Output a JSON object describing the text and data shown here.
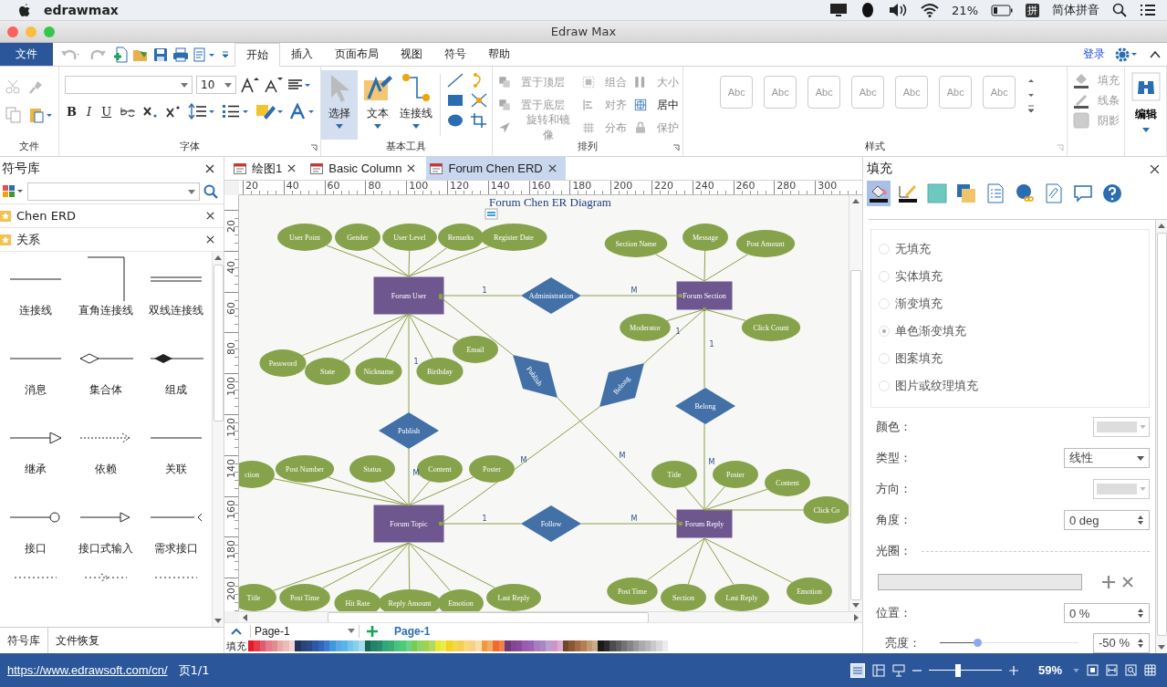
{
  "menubar": {
    "app": "edrawmax",
    "battery": "21%",
    "input_method_icon": "拼",
    "input_method": "简体拼音"
  },
  "window": {
    "title": "Edraw Max"
  },
  "ribbon": {
    "file_button": "文件",
    "tabs": [
      {
        "label": "开始",
        "selected": true
      },
      {
        "label": "插入",
        "selected": false
      },
      {
        "label": "页面布局",
        "selected": false
      },
      {
        "label": "视图",
        "selected": false
      },
      {
        "label": "符号",
        "selected": false
      },
      {
        "label": "帮助",
        "selected": false
      }
    ],
    "login": "登录",
    "file_group": "文件",
    "font_group": "字体",
    "font_size": "10",
    "font_styles": [
      "B",
      "I",
      "U"
    ],
    "basic_tools": {
      "label": "基本工具",
      "tools": [
        {
          "label": "选择",
          "selected": true
        },
        {
          "label": "文本",
          "selected": false
        },
        {
          "label": "连接线",
          "selected": false
        }
      ]
    },
    "arrange": {
      "label": "排列",
      "items": [
        {
          "label": "置于顶层",
          "disabled": true
        },
        {
          "label": "置于底层",
          "disabled": true
        },
        {
          "label": "旋转和镜像",
          "disabled": true
        },
        {
          "label": "组合",
          "disabled": true
        },
        {
          "label": "对齐",
          "disabled": true
        },
        {
          "label": "分布",
          "disabled": true
        },
        {
          "label": "大小",
          "disabled": true
        },
        {
          "label": "居中",
          "disabled": false
        },
        {
          "label": "保护",
          "disabled": true
        }
      ]
    },
    "styles": {
      "label": "样式",
      "swatches": [
        "Abc",
        "Abc",
        "Abc",
        "Abc",
        "Abc",
        "Abc",
        "Abc"
      ]
    },
    "shape_format": [
      {
        "label": "填充",
        "disabled": true
      },
      {
        "label": "线条",
        "disabled": true
      },
      {
        "label": "阴影",
        "disabled": true
      }
    ],
    "edit": "编辑"
  },
  "library": {
    "title": "符号库",
    "categories": [
      {
        "label": "Chen ERD"
      },
      {
        "label": "关系"
      }
    ],
    "shapes": [
      "连接线",
      "直角连接线",
      "双线连接线",
      "消息",
      "集合体",
      "组成",
      "继承",
      "依赖",
      "关联",
      "接口",
      "接口式输入",
      "需求接口"
    ],
    "tabs": [
      {
        "label": "符号库",
        "selected": true
      },
      {
        "label": "文件恢复",
        "selected": false
      }
    ]
  },
  "document_tabs": [
    {
      "label": "绘图1",
      "selected": false
    },
    {
      "label": "Basic Column",
      "selected": false
    },
    {
      "label": "Forum Chen ERD",
      "selected": true
    }
  ],
  "ruler": {
    "horizontal": [
      "20",
      "40",
      "60",
      "80",
      "100",
      "120",
      "140",
      "160",
      "180",
      "200",
      "220",
      "240",
      "260",
      "280",
      "300"
    ],
    "vertical": [
      "20",
      "40",
      "60",
      "80",
      "100",
      "120",
      "140",
      "160",
      "180",
      "200"
    ]
  },
  "diagram": {
    "title": "Forum Chen ER Diagram",
    "nodes": [
      {
        "kind": "entity",
        "label": "Forum User"
      },
      {
        "kind": "entity",
        "label": "Forum Section"
      },
      {
        "kind": "entity",
        "label": "Forum Topic"
      },
      {
        "kind": "entity",
        "label": "Forum Reply"
      },
      {
        "kind": "relationship",
        "label": "Administration"
      },
      {
        "kind": "relationship",
        "label": "Follow"
      },
      {
        "kind": "relationship",
        "label": "Publish"
      },
      {
        "kind": "relationship",
        "label": "Belong"
      },
      {
        "kind": "slanted",
        "label": "Publish"
      },
      {
        "kind": "slanted",
        "label": "Belong"
      },
      {
        "kind": "attribute",
        "label": "User Point"
      },
      {
        "kind": "attribute",
        "label": "Gender"
      },
      {
        "kind": "attribute",
        "label": "User Level"
      },
      {
        "kind": "attribute",
        "label": "Remarks"
      },
      {
        "kind": "attribute",
        "label": "Register Date"
      },
      {
        "kind": "attribute",
        "label": "Section Name"
      },
      {
        "kind": "attribute",
        "label": "Message"
      },
      {
        "kind": "attribute",
        "label": "Post Amount"
      },
      {
        "kind": "attribute",
        "label": "Moderator"
      },
      {
        "kind": "attribute",
        "label": "Click Count"
      },
      {
        "kind": "attribute",
        "label": "Password"
      },
      {
        "kind": "attribute",
        "label": "State"
      },
      {
        "kind": "attribute",
        "label": "Nickname"
      },
      {
        "kind": "attribute",
        "label": "Birthday"
      },
      {
        "kind": "attribute",
        "label": "Email"
      },
      {
        "kind": "attribute",
        "label": "ction"
      },
      {
        "kind": "attribute",
        "label": "Post Number"
      },
      {
        "kind": "attribute",
        "label": "Status"
      },
      {
        "kind": "attribute",
        "label": "Content"
      },
      {
        "kind": "attribute",
        "label": "Poster"
      },
      {
        "kind": "attribute",
        "label": "Title"
      },
      {
        "kind": "attribute",
        "label": "Post Time"
      },
      {
        "kind": "attribute",
        "label": "Hit Rate"
      },
      {
        "kind": "attribute",
        "label": "Reply Amount"
      },
      {
        "kind": "attribute",
        "label": "Emotion"
      },
      {
        "kind": "attribute",
        "label": "Last Reply"
      },
      {
        "kind": "attribute",
        "label": "Title"
      },
      {
        "kind": "attribute",
        "label": "Poster"
      },
      {
        "kind": "attribute",
        "label": "Content"
      },
      {
        "kind": "attribute",
        "label": "Click Co"
      },
      {
        "kind": "attribute",
        "label": "Post Time"
      },
      {
        "kind": "attribute",
        "label": "Section"
      },
      {
        "kind": "attribute",
        "label": "Last Reply"
      },
      {
        "kind": "attribute",
        "label": "Emotion"
      }
    ],
    "cardinalities": [
      "1",
      "M",
      "1",
      "M",
      "1",
      "M",
      "1",
      "M",
      "M",
      "1",
      "M"
    ]
  },
  "pages": {
    "dropdown": "Page-1",
    "tabs": [
      {
        "label": "Page-1",
        "selected": true
      }
    ],
    "fill_label": "填充"
  },
  "format_panel": {
    "title": "填充",
    "tools": [
      {
        "selected": true
      },
      {
        "selected": false
      },
      {
        "selected": false
      },
      {
        "selected": false
      },
      {
        "selected": false
      },
      {
        "selected": false
      },
      {
        "selected": false
      },
      {
        "selected": false
      },
      {
        "selected": false
      }
    ],
    "fill_options": [
      {
        "label": "无填充",
        "selected": false
      },
      {
        "label": "实体填充",
        "selected": false
      },
      {
        "label": "渐变填充",
        "selected": false
      },
      {
        "label": "单色渐变填充",
        "selected": true
      },
      {
        "label": "图案填充",
        "selected": false
      },
      {
        "label": "图片或纹理填充",
        "selected": false
      }
    ],
    "fields": [
      {
        "kind": "color",
        "label": "颜色："
      },
      {
        "kind": "select",
        "label": "类型：",
        "value": "线性"
      },
      {
        "kind": "color",
        "label": "方向："
      },
      {
        "kind": "spin",
        "label": "角度：",
        "value": "0 deg"
      },
      {
        "kind": "divider",
        "label": "光圈："
      },
      {
        "kind": "gradient"
      },
      {
        "kind": "spin",
        "label": "位置：",
        "value": "0 %"
      },
      {
        "kind": "slider",
        "label": "亮度：",
        "level": 0.27,
        "value": "-50 %"
      }
    ]
  },
  "status_bar": {
    "url": "https://www.edrawsoft.com/cn/",
    "page": "页1/1",
    "zoom": {
      "level": 0.4,
      "value": "59%"
    }
  }
}
